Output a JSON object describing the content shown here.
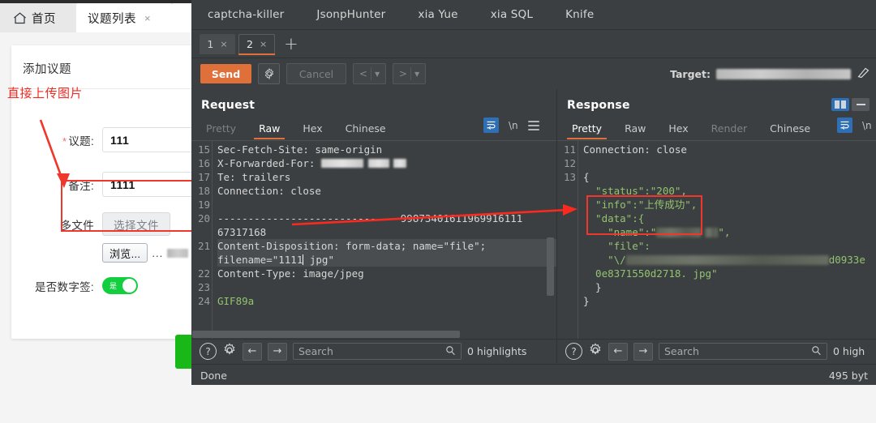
{
  "browser": {
    "tabs": [
      {
        "label": "首页",
        "icon": "home-icon",
        "active": false
      },
      {
        "label": "议题列表",
        "active": true,
        "close": "×"
      }
    ],
    "card": {
      "title": "添加议题",
      "fields": [
        {
          "label": "议题:",
          "required": true,
          "value": "111"
        },
        {
          "label": "备注:",
          "required": false,
          "value": "1111"
        }
      ],
      "file_row": {
        "label": "多文件",
        "choose_button": "选择文件",
        "browse_button": "浏览...",
        "dots": "..."
      },
      "switch_row": {
        "label": "是否数字签:",
        "state_label": "是"
      }
    },
    "annotation": {
      "text": "直接上传图片"
    }
  },
  "burp": {
    "top_tabs": [
      "captcha-killer",
      "JsonpHunter",
      "xia Yue",
      "xia SQL",
      "Knife"
    ],
    "sub_tabs": [
      {
        "label": "1",
        "close": "×",
        "selected": false
      },
      {
        "label": "2",
        "close": "×",
        "selected": true
      }
    ],
    "add_tab": "+",
    "toolbar": {
      "send": "Send",
      "settings_icon": "gear-icon",
      "cancel": "Cancel",
      "prev": "<",
      "next": ">",
      "dropdown_icon": "caret-down-icon",
      "target_label": "Target:",
      "target_value": "",
      "pencil_icon": "pencil-icon"
    },
    "request": {
      "title": "Request",
      "tabs": [
        {
          "label": "Pretty",
          "state": "dim"
        },
        {
          "label": "Raw",
          "state": "active"
        },
        {
          "label": "Hex",
          "state": "normal"
        },
        {
          "label": "Chinese",
          "state": "normal"
        }
      ],
      "tools": {
        "wrap_icon": "word-wrap-icon",
        "newline": "\\n",
        "menu_icon": "hamburger-menu-icon"
      },
      "lines": [
        {
          "no": "15",
          "text": "Sec-Fetch-Site: same-origin"
        },
        {
          "no": "16",
          "text": "X-Forwarded-For: ",
          "redacted": true
        },
        {
          "no": "17",
          "text": "Te: trailers"
        },
        {
          "no": "18",
          "text": "Connection: close"
        },
        {
          "no": "19",
          "text": ""
        },
        {
          "no": "20",
          "text": "------------------------------99873401611969916111"
        },
        {
          "no": "",
          "text": "67317168"
        },
        {
          "no": "21",
          "text": "Content-Disposition: form-data; name=\"file\";",
          "selected": true
        },
        {
          "no": "",
          "text": "filename=\"1111 jpg\"",
          "selected": true,
          "caret_after": "filename=\"1111"
        },
        {
          "no": "22",
          "text": "Content-Type: image/jpeg"
        },
        {
          "no": "23",
          "text": ""
        },
        {
          "no": "24",
          "text": "GIF89a",
          "color": "green"
        }
      ]
    },
    "response": {
      "title": "Response",
      "tabs": [
        {
          "label": "Pretty",
          "state": "active"
        },
        {
          "label": "Raw",
          "state": "normal"
        },
        {
          "label": "Hex",
          "state": "normal"
        },
        {
          "label": "Render",
          "state": "dim"
        },
        {
          "label": "Chinese",
          "state": "normal"
        }
      ],
      "tools": {
        "wrap_icon": "word-wrap-icon",
        "newline": "\\n"
      },
      "view_toggle": {
        "split_icon": "split-view-icon",
        "stack_icon": "stacked-view-icon"
      },
      "lines": [
        {
          "no": "11",
          "text": "Connection: close"
        },
        {
          "no": "12",
          "text": ""
        },
        {
          "no": "13",
          "text": "{"
        },
        {
          "no": "",
          "text": "  \"status\":\"200\",",
          "color": "green"
        },
        {
          "no": "",
          "text": "  \"info\":\"上传成功\",",
          "color": "green"
        },
        {
          "no": "",
          "text": "  \"data\":{",
          "color": "green"
        },
        {
          "no": "",
          "text": "    \"name\":\"",
          "color": "green",
          "redacted": true
        },
        {
          "no": "",
          "text": "    \"file\":",
          "color": "green"
        },
        {
          "no": "",
          "text": "    \"\\/",
          "color": "green",
          "redacted": true,
          "tail": "d0933e"
        },
        {
          "no": "",
          "text": "  0e8371550d2718. jpg\"",
          "color": "green"
        },
        {
          "no": "",
          "text": "  }"
        },
        {
          "no": "",
          "text": "}"
        }
      ]
    },
    "find_request": {
      "help_icon": "help-icon",
      "settings_icon": "gear-icon",
      "back_icon": "arrow-left-icon",
      "forward_icon": "arrow-right-icon",
      "search_placeholder": "Search",
      "search_icon": "magnifier-icon",
      "highlights": "0 highlights"
    },
    "find_response": {
      "help_icon": "help-icon",
      "settings_icon": "gear-icon",
      "back_icon": "arrow-left-icon",
      "forward_icon": "arrow-right-icon",
      "search_placeholder": "Search",
      "search_icon": "magnifier-icon",
      "highlights": "0 high"
    },
    "status": {
      "left": "Done",
      "right": "495 byt"
    }
  },
  "colors": {
    "accent_orange": "#e0703a",
    "annotation_red": "#f0372b",
    "switch_green": "#13ce3f",
    "submit_green": "#17b817",
    "code_green": "#93c36f",
    "burp_bg": "#3c3f41"
  }
}
